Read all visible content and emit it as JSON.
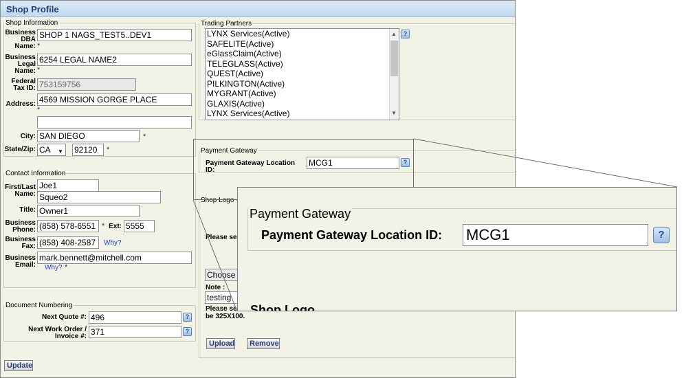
{
  "window": {
    "title": "Shop Profile"
  },
  "shop_info": {
    "legend": "Shop Information",
    "dba_label": "Business DBA Name:",
    "dba_value": "SHOP 1 NAGS_TEST5..DEV1",
    "legal_label": "Business Legal Name:",
    "legal_value": "6254 LEGAL NAME2",
    "tax_label": "Federal Tax ID:",
    "tax_value": "753159756",
    "address_label": "Address:",
    "address_value": "4569 MISSION GORGE PLACE",
    "address2_value": "",
    "city_label": "City:",
    "city_value": "SAN DIEGO",
    "statezip_label": "State/Zip:",
    "state_value": "CA",
    "zip_value": "92120",
    "required_mark": "*"
  },
  "contact": {
    "legend": "Contact Information",
    "name_label": "First/Last Name:",
    "first_value": "Joe1",
    "last_value": "Squeo2",
    "title_label": "Title:",
    "title_value": "Owner1",
    "phone_label": "Business Phone:",
    "phone_value": "(858) 578-6551",
    "ext_label": "Ext:",
    "ext_value": "5555",
    "fax_label": "Business Fax:",
    "fax_value": "(858) 408-2587",
    "why_label": "Why?",
    "email_label": "Business Email:",
    "email_value": "mark.bennett@mitchell.com"
  },
  "doc_numbering": {
    "legend": "Document Numbering",
    "quote_label": "Next Quote #:",
    "quote_value": "496",
    "wo_label": "Next Work Order / Invoice #:",
    "wo_value": "371"
  },
  "update_button": "Update",
  "trading_partners": {
    "legend": "Trading Partners",
    "items": [
      "LYNX Services(Active)",
      "SAFELITE(Active)",
      "eGlassClaim(Active)",
      "TELEGLASS(Active)",
      "QUEST(Active)",
      "PILKINGTON(Active)",
      "MYGRANT(Active)",
      "GLAXIS(Active)",
      "LYNX Services(Active)"
    ]
  },
  "payment_gateway": {
    "legend": "Payment Gateway",
    "location_label": "Payment Gateway Location ID:",
    "location_value": "MCG1"
  },
  "shop_logo": {
    "legend": "Shop Logo",
    "please_select_1": "Please sel",
    "choose_label": "Choose",
    "note_label": "Note :",
    "note_value": "testing",
    "please_select_2": "Please sel",
    "size_note": "be 325X100.",
    "upload_button": "Upload",
    "remove_button": "Remove"
  },
  "zoom": {
    "legend": "Payment Gateway",
    "location_label": "Payment Gateway Location ID:",
    "location_value": "MCG1",
    "next_legend": "Shop Logo"
  },
  "icons": {
    "help": "help-icon",
    "required": "asterisk"
  },
  "help_glyph": "?",
  "arrows": {
    "up": "▲",
    "down": "▼"
  }
}
